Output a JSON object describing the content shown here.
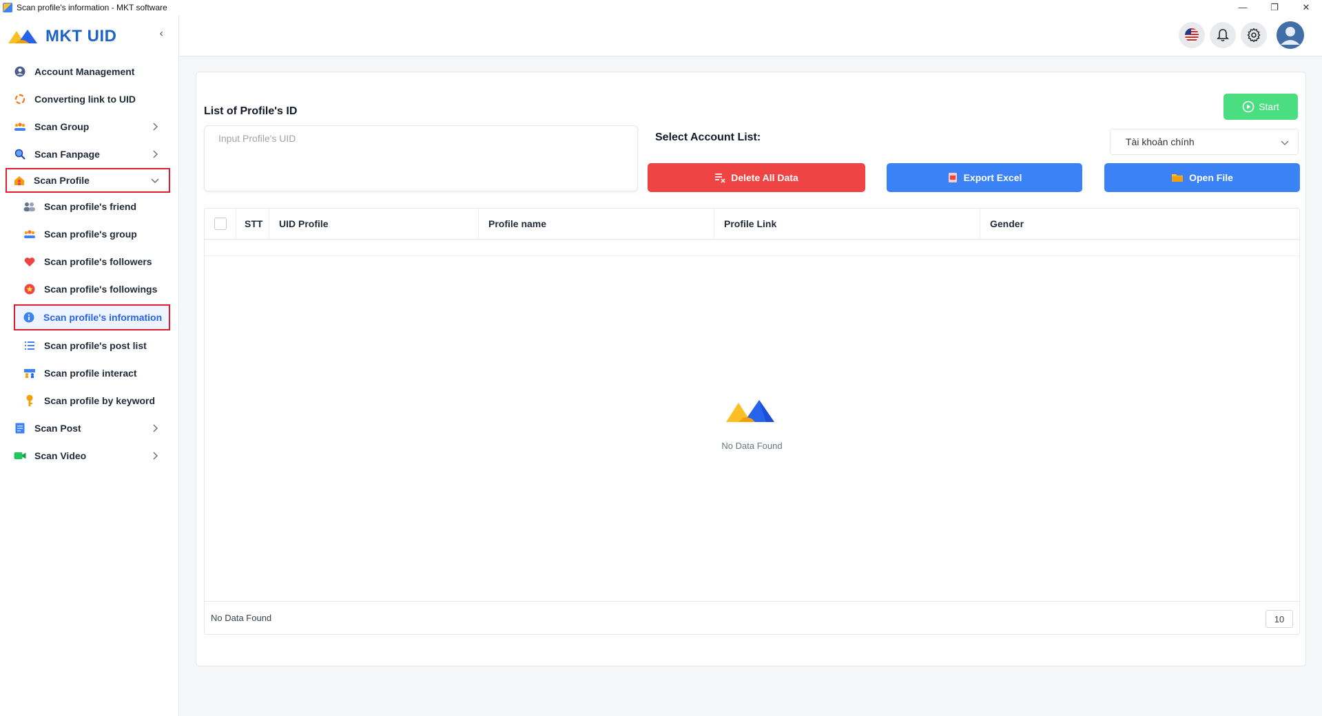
{
  "window": {
    "title": "Scan profile's information - MKT software",
    "controls": [
      "—",
      "❐",
      "✕"
    ]
  },
  "brand": {
    "name": "MKT UID"
  },
  "sidebar": {
    "items": [
      {
        "label": "Account Management",
        "icon": "account-circle-icon"
      },
      {
        "label": "Converting link to UID",
        "icon": "convert-icon"
      },
      {
        "label": "Scan Group",
        "icon": "group-icon"
      },
      {
        "label": "Scan Fanpage",
        "icon": "search-icon"
      },
      {
        "label": "Scan Profile",
        "icon": "profile-house-icon"
      },
      {
        "label": "Scan Post",
        "icon": "post-icon"
      },
      {
        "label": "Scan Video",
        "icon": "video-camera-icon"
      }
    ],
    "profile_subitems": [
      {
        "label": "Scan profile's friend",
        "icon": "friends-icon"
      },
      {
        "label": "Scan profile's group",
        "icon": "group-icon"
      },
      {
        "label": "Scan profile's followers",
        "icon": "heart-icon"
      },
      {
        "label": "Scan profile's followings",
        "icon": "star-icon"
      },
      {
        "label": "Scan profile's information",
        "icon": "info-icon"
      },
      {
        "label": "Scan profile's post list",
        "icon": "list-icon"
      },
      {
        "label": "Scan profile interact",
        "icon": "interact-icon"
      },
      {
        "label": "Scan profile by keyword",
        "icon": "key-icon"
      }
    ]
  },
  "main": {
    "section_title": "List of Profile's ID",
    "uid_placeholder": "Input Profile's UID",
    "account_label": "Select Account List:",
    "account_selected": "Tài khoản chính",
    "start_label": "Start",
    "delete_label": "Delete All Data",
    "export_label": "Export Excel",
    "open_label": "Open File"
  },
  "table": {
    "columns": [
      "STT",
      "UID Profile",
      "Profile name",
      "Profile Link",
      "Gender"
    ],
    "empty_text": "No Data Found",
    "footer_text": "No Data Found",
    "page_size": "10"
  },
  "colors": {
    "brand_blue": "#1e63c8",
    "danger": "#ef4444",
    "primary": "#3b82f6",
    "success": "#4ade80",
    "highlight_outline": "#e11d2d"
  }
}
